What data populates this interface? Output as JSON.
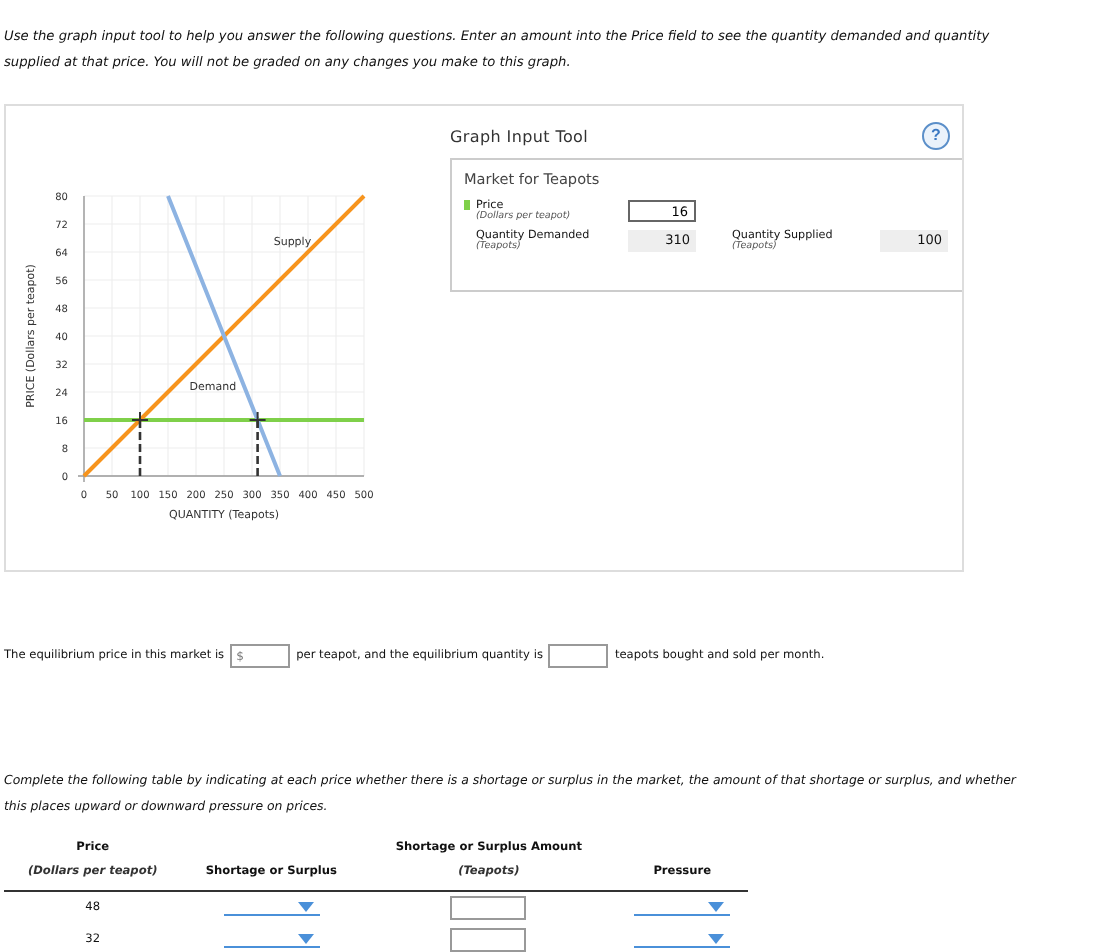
{
  "intro": "Use the graph input tool to help you answer the following questions. Enter an amount into the Price field to see the quantity demanded and quantity supplied at that price. You will not be graded on any changes you make to this graph.",
  "graph": {
    "chart_data": {
      "type": "line",
      "xlabel": "QUANTITY (Teapots)",
      "ylabel": "PRICE (Dollars per teapot)",
      "x": [
        0,
        100,
        150,
        250,
        310,
        350,
        500
      ],
      "series": [
        {
          "name": "Supply",
          "color": "#f7941d",
          "values": [
            0,
            16,
            24,
            40,
            49.6,
            56,
            80
          ]
        },
        {
          "name": "Demand",
          "color": "#8db3e2",
          "values": [
            null,
            null,
            80,
            40,
            16,
            0,
            null
          ]
        }
      ],
      "ref_lines": [
        {
          "axis": "y",
          "value": 16,
          "color": "#7fd04a"
        }
      ],
      "grid": true,
      "xlim": [
        0,
        500
      ],
      "ylim": [
        0,
        80
      ],
      "xticks": [
        0,
        50,
        100,
        150,
        200,
        250,
        300,
        350,
        400,
        450,
        500
      ],
      "yticks": [
        0,
        8,
        16,
        24,
        32,
        40,
        48,
        56,
        64,
        72,
        80
      ]
    }
  },
  "tool": {
    "title": "Graph Input Tool",
    "help": "?",
    "market": "Market for Teapots",
    "price_label": "Price",
    "price_unit": "(Dollars per teapot)",
    "price_value": "16",
    "qd_label": "Quantity Demanded",
    "qd_unit": "(Teapots)",
    "qd_value": "310",
    "qs_label": "Quantity Supplied",
    "qs_unit": "(Teapots)",
    "qs_value": "100"
  },
  "equilibrium": {
    "part1": "The equilibrium price in this market is",
    "price_placeholder": "$",
    "part2": "per teapot, and the equilibrium quantity is",
    "part3": "teapots bought and sold per month."
  },
  "table_intro": "Complete the following table by indicating at each price whether there is a shortage or surplus in the market, the amount of that shortage or surplus, and whether this places upward or downward pressure on prices.",
  "table": {
    "columns": [
      {
        "title": "Price",
        "sub": "(Dollars per teapot)"
      },
      {
        "title": "Shortage or Surplus"
      },
      {
        "title": "Shortage or Surplus Amount",
        "sub": "(Teapots)"
      },
      {
        "title": "Pressure"
      }
    ],
    "rows": [
      {
        "price": "48"
      },
      {
        "price": "32"
      }
    ]
  }
}
